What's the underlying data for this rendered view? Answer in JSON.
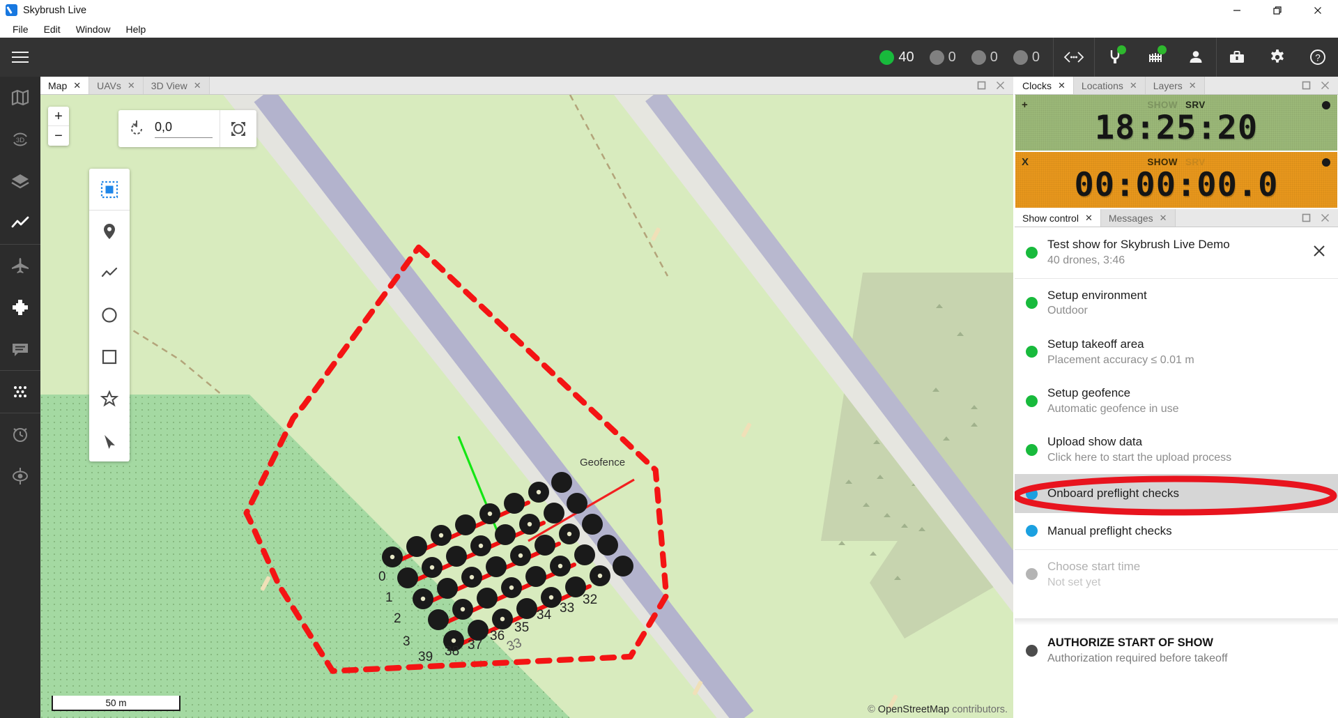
{
  "window": {
    "title": "Skybrush Live",
    "logo_icon": "skybrush-logo-icon",
    "controls": [
      {
        "name": "minimize",
        "icon": "minimize-icon"
      },
      {
        "name": "maximize",
        "icon": "maximize-icon"
      },
      {
        "name": "close",
        "icon": "close-icon"
      }
    ]
  },
  "menubar": {
    "items": [
      "File",
      "Edit",
      "Window",
      "Help"
    ]
  },
  "toolbar": {
    "hamburger_icon": "hamburger-menu-icon",
    "counts": [
      {
        "label": "40",
        "color": "#18ba3c",
        "state": "ok"
      },
      {
        "label": "0",
        "color": "#808080",
        "state": "warning"
      },
      {
        "label": "0",
        "color": "#808080",
        "state": "error"
      },
      {
        "label": "0",
        "color": "#808080",
        "state": "critical"
      }
    ],
    "icons": [
      {
        "name": "connection-icon",
        "glyph": "<···>",
        "badge": false
      },
      {
        "name": "plug-icon",
        "badge": true,
        "badge_color": "#2eb82e"
      },
      {
        "name": "fence-icon",
        "badge": true,
        "badge_color": "#2eb82e"
      },
      {
        "name": "person-icon",
        "badge": false
      },
      {
        "name": "briefcase-icon",
        "badge": false
      },
      {
        "name": "gear-icon",
        "badge": false
      },
      {
        "name": "help-icon",
        "badge": false
      }
    ]
  },
  "sidebar": {
    "items": [
      {
        "name": "map",
        "icon": "map-icon",
        "active": false
      },
      {
        "name": "three-d-view",
        "icon": "3d-icon",
        "active": false
      },
      {
        "name": "layers",
        "icon": "layers-icon",
        "active": false
      },
      {
        "name": "chart",
        "icon": "line-chart-icon",
        "active": true
      },
      {
        "name": "uavs",
        "icon": "airplane-icon",
        "active": false
      },
      {
        "name": "drone-control",
        "icon": "drone-icon",
        "active": true
      },
      {
        "name": "messages",
        "icon": "chat-icon",
        "active": false
      },
      {
        "name": "show-control",
        "icon": "dot-grid-icon",
        "active": true
      },
      {
        "name": "clocks",
        "icon": "alarm-clock-icon",
        "active": false
      },
      {
        "name": "locations",
        "icon": "target-icon",
        "active": false
      }
    ]
  },
  "map_panel": {
    "tabs": [
      {
        "label": "Map",
        "active": true
      },
      {
        "label": "UAVs",
        "active": false
      },
      {
        "label": "3D View",
        "active": false
      }
    ],
    "actions": [
      {
        "name": "maximize-panel",
        "icon": "maximize-panel-icon"
      },
      {
        "name": "close-panel",
        "icon": "close-panel-icon"
      }
    ],
    "zoom_in_label": "+",
    "zoom_out_label": "−",
    "rotation": {
      "reset_icon": "rotate-reset-icon",
      "value": "0,0",
      "fit_icon": "fit-to-view-icon"
    },
    "tools": [
      {
        "name": "select-tool",
        "icon": "dotted-square-icon",
        "selected": true
      },
      {
        "name": "add-marker-tool",
        "icon": "map-pin-icon",
        "selected": false
      },
      {
        "name": "draw-path-tool",
        "icon": "polyline-icon",
        "selected": false
      },
      {
        "name": "draw-circle-tool",
        "icon": "circle-icon",
        "selected": false
      },
      {
        "name": "draw-rectangle-tool",
        "icon": "square-icon",
        "selected": false
      },
      {
        "name": "draw-polygon-tool",
        "icon": "star-icon",
        "selected": false
      },
      {
        "name": "pan-tool",
        "icon": "cursor-arrow-icon",
        "selected": false
      }
    ],
    "geofence_label": "Geofence",
    "scale_label": "50 m",
    "attribution_symbol": "©",
    "attribution_link": "OpenStreetMap",
    "attribution_rest": "contributors.",
    "drone_labels": [
      "0",
      "1",
      "2",
      "3",
      "39",
      "38",
      "37",
      "36",
      "35",
      "34",
      "33",
      "32",
      "33"
    ]
  },
  "clocks_panel": {
    "tabs": [
      {
        "label": "Clocks",
        "active": true
      },
      {
        "label": "Locations",
        "active": false
      },
      {
        "label": "Layers",
        "active": false
      }
    ],
    "actions": [
      {
        "name": "maximize-panel",
        "icon": "maximize-panel-icon"
      },
      {
        "name": "close-panel",
        "icon": "close-panel-icon"
      }
    ],
    "clocks": [
      {
        "name": "server-clock",
        "corner_label": "+",
        "mode_left": "SHOW",
        "mode_right": "SRV",
        "active_mode": "right",
        "time": "18:25:20",
        "color": "#9bb878",
        "running": true
      },
      {
        "name": "show-clock",
        "corner_label": "X",
        "mode_left": "SHOW",
        "mode_right": "SRV",
        "active_mode": "left",
        "time": "00:00:00.0",
        "color": "#e8971c",
        "running": true
      }
    ]
  },
  "show_control": {
    "tabs": [
      {
        "label": "Show control",
        "active": true
      },
      {
        "label": "Messages",
        "active": false
      }
    ],
    "actions": [
      {
        "name": "maximize-panel",
        "icon": "maximize-panel-icon"
      },
      {
        "name": "close-panel",
        "icon": "close-panel-icon"
      }
    ],
    "header": {
      "title": "Test show for Skybrush Live Demo",
      "subtitle": "40 drones, 3:46",
      "status_color": "#18ba3c",
      "close_icon": "close-icon"
    },
    "steps": [
      {
        "title": "Setup environment",
        "subtitle": "Outdoor",
        "status": "green",
        "highlighted": false
      },
      {
        "title": "Setup takeoff area",
        "subtitle": "Placement accuracy ≤ 0.01 m",
        "status": "green",
        "highlighted": false
      },
      {
        "title": "Setup geofence",
        "subtitle": "Automatic geofence in use",
        "status": "green",
        "highlighted": false
      },
      {
        "title": "Upload show data",
        "subtitle": "Click here to start the upload process",
        "status": "green",
        "highlighted": false
      },
      {
        "title": "Onboard preflight checks",
        "subtitle": "",
        "status": "blue",
        "highlighted": true
      },
      {
        "title": "Manual preflight checks",
        "subtitle": "",
        "status": "blue",
        "highlighted": false
      },
      {
        "title": "Choose start time",
        "subtitle": "Not set yet",
        "status": "grey",
        "highlighted": false,
        "disabled": true
      }
    ],
    "authorize": {
      "title": "AUTHORIZE START OF SHOW",
      "subtitle": "Authorization required before takeoff",
      "status": "dark"
    },
    "annotation": {
      "name": "red-highlight-ellipse",
      "color": "#e8141e",
      "target": "Onboard preflight checks"
    }
  }
}
